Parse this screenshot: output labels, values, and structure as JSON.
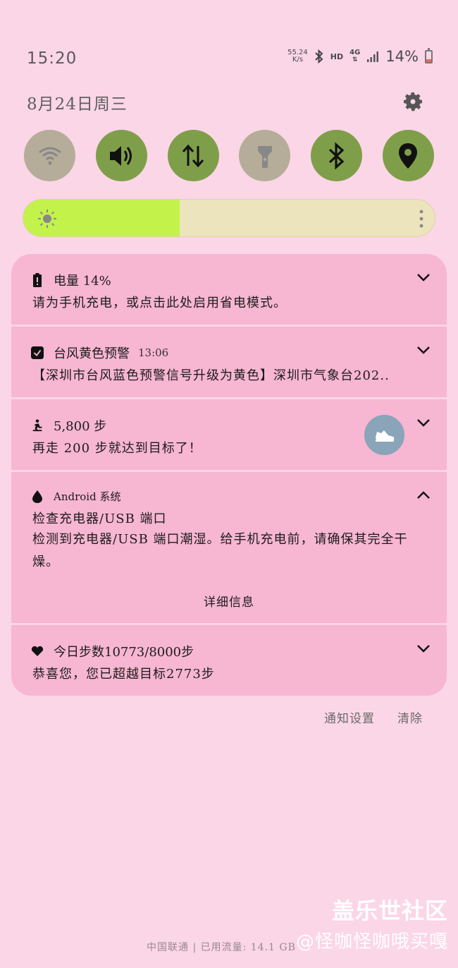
{
  "status_bar": {
    "time": "15:20",
    "net_speed_value": "55.24",
    "net_speed_unit": "K/s",
    "hd": "HD",
    "network": "4G",
    "battery": "14%",
    "battery_level": 0.14
  },
  "header": {
    "date": "8月24日周三"
  },
  "quick_toggles": [
    {
      "name": "wifi",
      "state": "off"
    },
    {
      "name": "sound",
      "state": "on"
    },
    {
      "name": "mobile-data",
      "state": "on"
    },
    {
      "name": "flashlight",
      "state": "off"
    },
    {
      "name": "bluetooth",
      "state": "on"
    },
    {
      "name": "location",
      "state": "on"
    }
  ],
  "brightness": {
    "level": 0.38
  },
  "notifications": [
    {
      "title": "电量 14%",
      "body": "请为手机充电，或点击此处启用省电模式。",
      "icon": "battery-icon"
    },
    {
      "title": "台风黄色预警",
      "time": "13:06",
      "body": "【深圳市台风蓝色预警信号升级为黄色】深圳市气象台202..",
      "icon": "weather-app-icon"
    },
    {
      "title": "5,800 步",
      "body": "再走 200 步就达到目标了！",
      "icon": "walking-icon"
    },
    {
      "app": "Android 系统",
      "title": "检查充电器/USB 端口",
      "body": "检测到充电器/USB 端口潮湿。给手机充电前，请确保其完全干燥。",
      "action": "详细信息",
      "icon": "water-drop-icon"
    },
    {
      "title": "今日步数10773/8000步",
      "body": "恭喜您，您已超越目标2773步",
      "icon": "heart-icon"
    }
  ],
  "footer": {
    "settings": "通知设置",
    "clear": "清除"
  },
  "bottom": {
    "carrier": "中国联通 | 已用流量: 14.1 GB"
  },
  "watermark": {
    "line1": "盖乐世社区",
    "line2": "@怪咖怪咖哦买嘎"
  },
  "colors": {
    "background": "#fbd6e6",
    "card": "#f7b6d2",
    "toggle_on": "#7f9e4a",
    "toggle_off": "#b5ad99",
    "brightness_fill": "#c3f24a"
  }
}
